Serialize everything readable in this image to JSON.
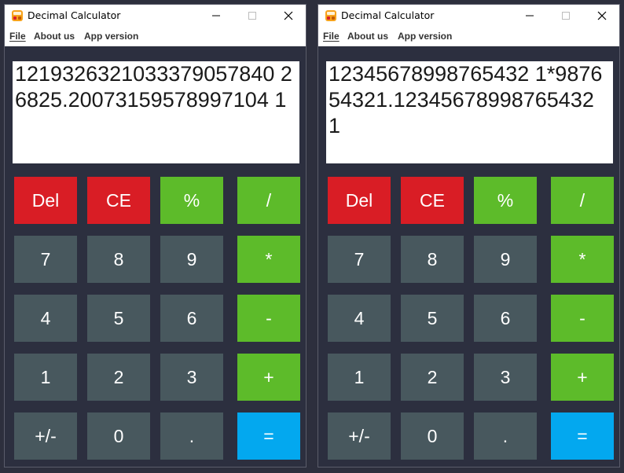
{
  "colors": {
    "background": "#2c2f3f",
    "red_button": "#d91d25",
    "green_button": "#5dbb2a",
    "gray_button": "#48585e",
    "equals_button": "#03a8ef"
  },
  "windows": [
    {
      "title": "Decimal Calculator",
      "icon": "calculator-app-icon",
      "menu": {
        "file": "File",
        "about": "About us",
        "version": "App version"
      },
      "display": "1219326321033379057840 26825.20073159578997104 1"
    },
    {
      "title": "Decimal Calculator",
      "icon": "calculator-app-icon",
      "menu": {
        "file": "File",
        "about": "About us",
        "version": "App version"
      },
      "display": "12345678998765432 1*9876 54321.12345678998765432 1"
    }
  ],
  "keys": {
    "del": "Del",
    "ce": "CE",
    "percent": "%",
    "divide": "/",
    "seven": "7",
    "eight": "8",
    "nine": "9",
    "multiply": "*",
    "four": "4",
    "five": "5",
    "six": "6",
    "minus": "-",
    "one": "1",
    "two": "2",
    "three": "3",
    "plus": "+",
    "negate": "+/-",
    "zero": "0",
    "dot": ".",
    "equals": "="
  }
}
